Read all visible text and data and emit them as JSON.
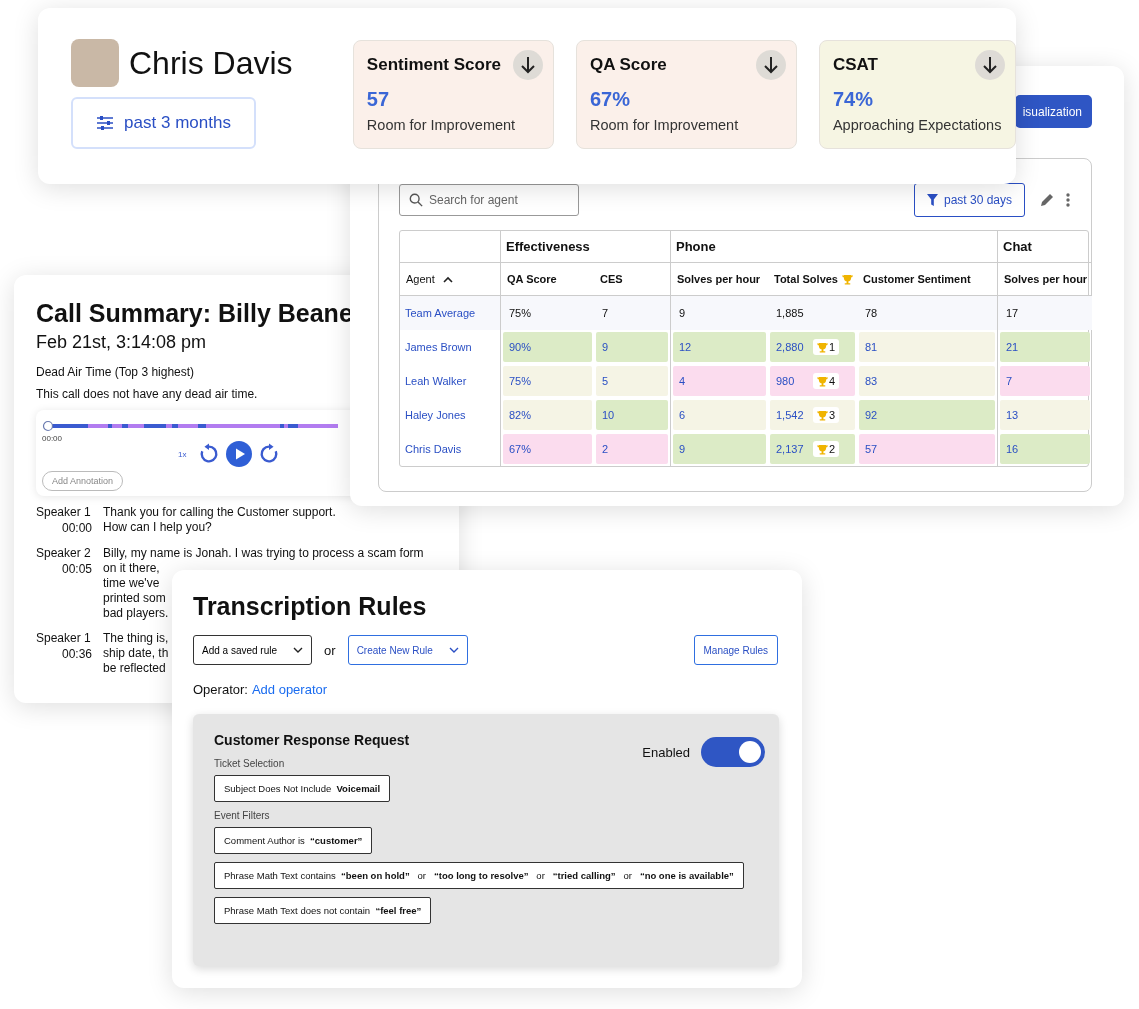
{
  "profile": {
    "name": "Chris Davis",
    "period_button": "past 3 months",
    "metrics": [
      {
        "title": "Sentiment Score",
        "value": "57",
        "caption": "Room for Improvement",
        "color": "#fbf0ea"
      },
      {
        "title": "QA Score",
        "value": "67%",
        "caption": "Room for Improvement",
        "color": "#fbf0ea"
      },
      {
        "title": "CSAT",
        "value": "74%",
        "caption": "Approaching Expectations",
        "color": "#f6f5e3"
      }
    ]
  },
  "leaderboard": {
    "visualization_button": "isualization",
    "search": {
      "placeholder": "Search for agent"
    },
    "period_filter": "past 30 days",
    "agent_column": "Agent",
    "groups": [
      {
        "label": "Effectiveness",
        "columns": [
          {
            "label": "QA Score",
            "kind": "plain"
          },
          {
            "label": "CES",
            "kind": "plain"
          }
        ]
      },
      {
        "label": "Phone",
        "columns": [
          {
            "label": "Solves per hour",
            "kind": "plain"
          },
          {
            "label": "Total Solves",
            "kind": "ranked"
          },
          {
            "label": "Customer Sentiment",
            "kind": "plain"
          }
        ]
      },
      {
        "label": "Chat",
        "columns": [
          {
            "label": "Solves per hour",
            "kind": "plain"
          }
        ]
      }
    ],
    "rows": [
      {
        "kind": "average",
        "agent": "Team Average",
        "cells": [
          {
            "text": "75%"
          },
          {
            "text": "7"
          },
          {
            "text": "9"
          },
          {
            "text": "1,885"
          },
          {
            "text": "78"
          },
          {
            "text": "17"
          }
        ]
      },
      {
        "kind": "agent",
        "agent": "James Brown",
        "cells": [
          {
            "text": "90%",
            "color": "#dcebc6"
          },
          {
            "text": "9",
            "color": "#dcebc6"
          },
          {
            "text": "12",
            "color": "#dcebc6"
          },
          {
            "text": "2,880",
            "color": "#dcebc6",
            "rank": "1"
          },
          {
            "text": "81",
            "color": "#f5f4e5"
          },
          {
            "text": "21",
            "color": "#dcebc6"
          }
        ]
      },
      {
        "kind": "agent",
        "agent": "Leah Walker",
        "cells": [
          {
            "text": "75%",
            "color": "#f5f4e5"
          },
          {
            "text": "5",
            "color": "#f5f4e5"
          },
          {
            "text": "4",
            "color": "#fbdcee"
          },
          {
            "text": "980",
            "color": "#fbdcee",
            "rank": "4"
          },
          {
            "text": "83",
            "color": "#f5f4e5"
          },
          {
            "text": "7",
            "color": "#fbdcee"
          }
        ]
      },
      {
        "kind": "agent",
        "agent": "Haley Jones",
        "cells": [
          {
            "text": "82%",
            "color": "#f5f4e5"
          },
          {
            "text": "10",
            "color": "#dcebc6"
          },
          {
            "text": "6",
            "color": "#f5f4e5"
          },
          {
            "text": "1,542",
            "color": "#f5f4e5",
            "rank": "3"
          },
          {
            "text": "92",
            "color": "#dcebc6"
          },
          {
            "text": "13",
            "color": "#f5f4e5"
          }
        ]
      },
      {
        "kind": "agent",
        "agent": "Chris Davis",
        "cells": [
          {
            "text": "67%",
            "color": "#fbdcee"
          },
          {
            "text": "2",
            "color": "#fbdcee"
          },
          {
            "text": "9",
            "color": "#dcebc6"
          },
          {
            "text": "2,137",
            "color": "#dcebc6",
            "rank": "2"
          },
          {
            "text": "57",
            "color": "#fbdcee"
          },
          {
            "text": "16",
            "color": "#dcebc6"
          }
        ]
      }
    ]
  },
  "call_summary": {
    "title": "Call Summary: Billy Beane",
    "datetime": "Feb 21st, 3:14:08 pm",
    "dead_air_label": "Dead Air Time (Top 3 highest)",
    "dead_air_text": "This call does not have any dead air time.",
    "player": {
      "time": "00:00",
      "speed": "1x",
      "annotation_button": "Add Annotation"
    },
    "transcript": [
      {
        "speaker": "Speaker 1",
        "time": "00:00",
        "lines": [
          "Thank you for calling the Customer support.",
          "How can I help you?"
        ]
      },
      {
        "speaker": "Speaker 2",
        "time": "00:05",
        "lines": [
          "Billy, my name is Jonah. I was trying to process a scam form",
          "on it there,",
          "time we've",
          "printed som",
          "bad players."
        ]
      },
      {
        "speaker": "Speaker 1",
        "time": "00:36",
        "lines": [
          "The thing is,",
          "ship date, th",
          "be reflected"
        ]
      }
    ]
  },
  "rules": {
    "title": "Transcription Rules",
    "saved_rule_dropdown": "Add a saved rule",
    "or": "or",
    "create_dropdown": "Create New Rule",
    "manage_button": "Manage Rules",
    "operator_label": "Operator:",
    "operator_link": "Add operator",
    "rule": {
      "name": "Customer Response Request",
      "enabled_label": "Enabled",
      "enabled": true,
      "sections": [
        {
          "label": "Ticket Selection",
          "filters": [
            "Subject Does Not Include  **Voicemail**"
          ]
        },
        {
          "label": "Event Filters",
          "filters": [
            "Comment Author is  **“customer”**",
            "Phrase Math Text contains  **“been on hold”**   or   **“too long to resolve”**   or   **“tried calling”**   or   **“no one is available”**",
            "Phrase Math Text does not contain  **“feel free”**"
          ]
        }
      ]
    }
  }
}
